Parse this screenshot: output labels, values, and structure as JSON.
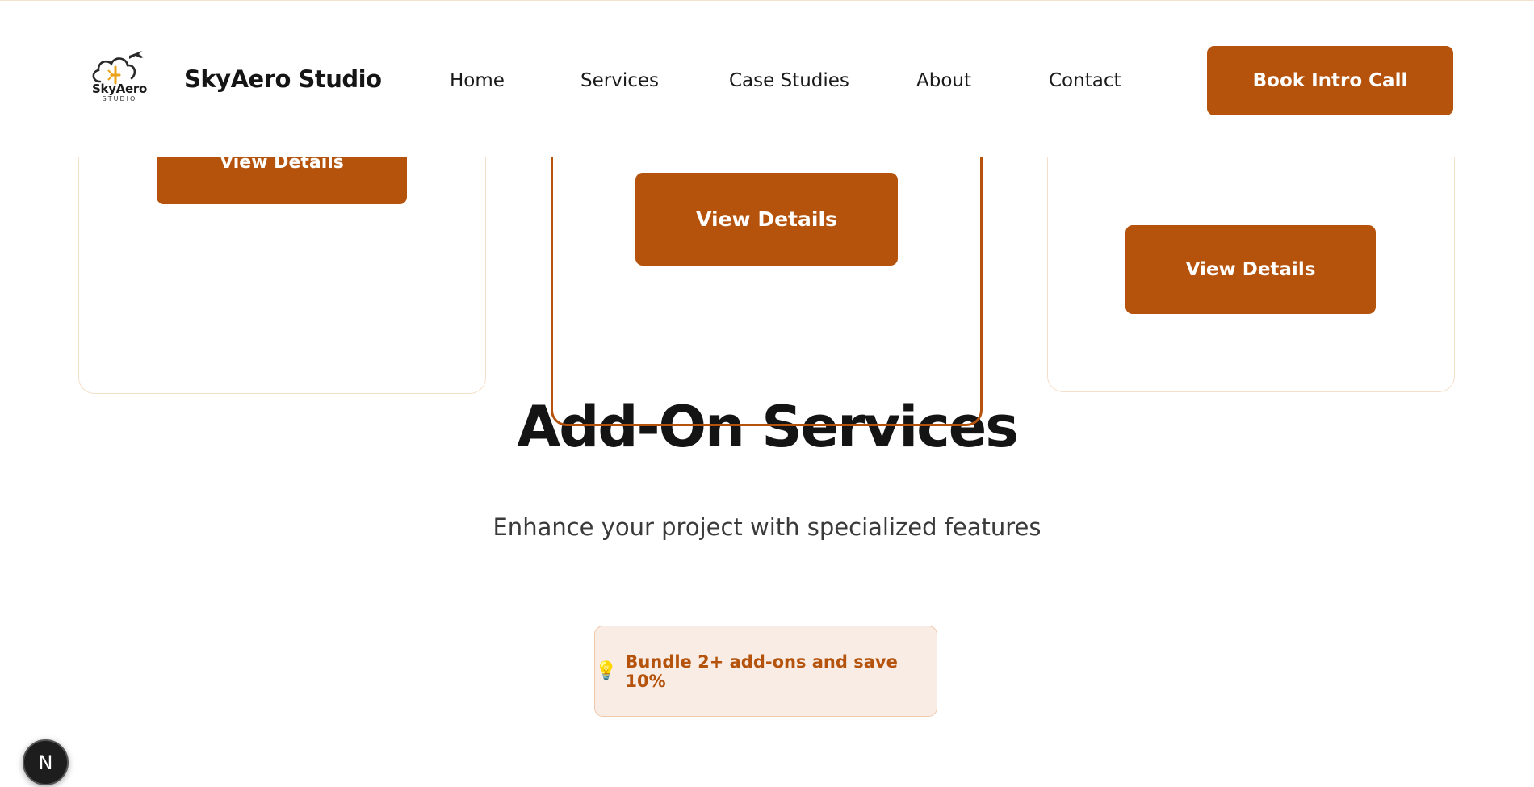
{
  "header": {
    "logo_word": "SkyAero",
    "logo_sub": "STUDIO",
    "brand": "SkyAero Studio",
    "nav": [
      {
        "label": "Home"
      },
      {
        "label": "Services"
      },
      {
        "label": "Case Studies"
      },
      {
        "label": "About"
      },
      {
        "label": "Contact"
      }
    ],
    "cta_label": "Book Intro Call"
  },
  "cards": [
    {
      "button_label": "View Details"
    },
    {
      "button_label": "View Details"
    },
    {
      "button_label": "View Details"
    }
  ],
  "addons": {
    "title": "Add-On Services",
    "subtitle": "Enhance your project with specialized features",
    "bundle_icon": "lightbulb-icon",
    "bundle_text": "Bundle 2+ add-ons and save 10%"
  },
  "badge": {
    "letter": "N"
  },
  "colors": {
    "accent": "#b5530d",
    "card_border": "#f4dfc9",
    "bundle_bg": "#f8ece4"
  }
}
